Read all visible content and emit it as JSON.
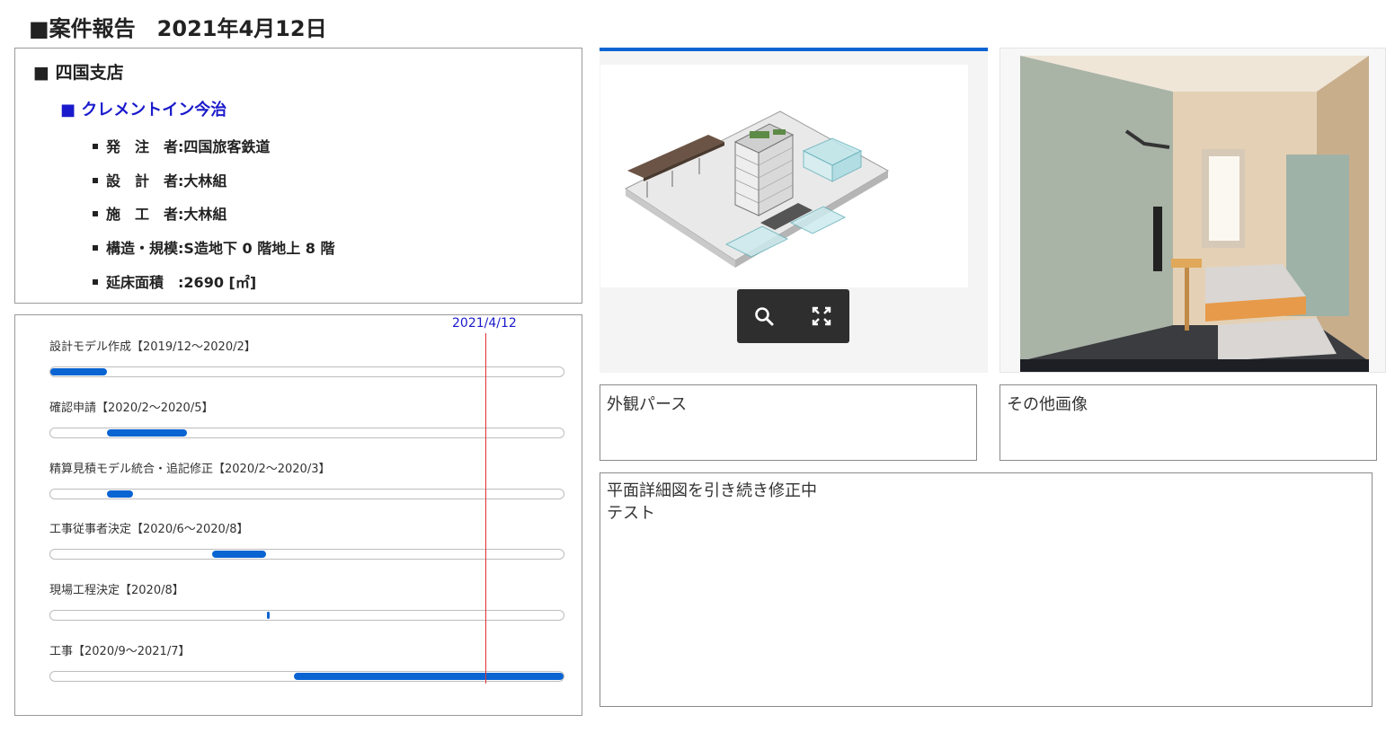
{
  "report": {
    "title": "■案件報告　2021年4月12日"
  },
  "info": {
    "branch": "■ 四国支店",
    "project": "■ クレメントイン今治",
    "details": [
      {
        "label": "発　注　者",
        "value": "四国旅客鉄道"
      },
      {
        "label": "設　計　者",
        "value": "大林組"
      },
      {
        "label": "施　工　者",
        "value": "大林組"
      },
      {
        "label": "構造・規模",
        "value": "S造地下 0 階地上 8 階"
      },
      {
        "label": "延床面積　",
        "value": "2690 [㎡]"
      }
    ],
    "separator": ":"
  },
  "schedule": {
    "today_label": "2021/4/12",
    "today_fraction": 0.85,
    "tasks": [
      {
        "label": "設計モデル作成【2019/12～2020/2】",
        "start": 0.0,
        "end": 0.11
      },
      {
        "label": "確認申請【2020/2～2020/5】",
        "start": 0.11,
        "end": 0.265
      },
      {
        "label": "精算見積モデル統合・追記修正【2020/2～2020/3】",
        "start": 0.11,
        "end": 0.16
      },
      {
        "label": "工事従事者決定【2020/6～2020/8】",
        "start": 0.315,
        "end": 0.42
      },
      {
        "label": "現場工程決定【2020/8】",
        "start": 0.422,
        "end": 0.428
      },
      {
        "label": "工事【2020/9～2021/7】",
        "start": 0.475,
        "end": 1.0
      }
    ]
  },
  "viewer": {
    "zoom_icon": "search-icon",
    "fullscreen_icon": "fullscreen-icon",
    "accent": "#0a64d2"
  },
  "captions": {
    "exterior": "外観パース",
    "other": "その他画像"
  },
  "notes": {
    "line1": "平面詳細図を引き続き修正中",
    "line2": "テスト"
  }
}
